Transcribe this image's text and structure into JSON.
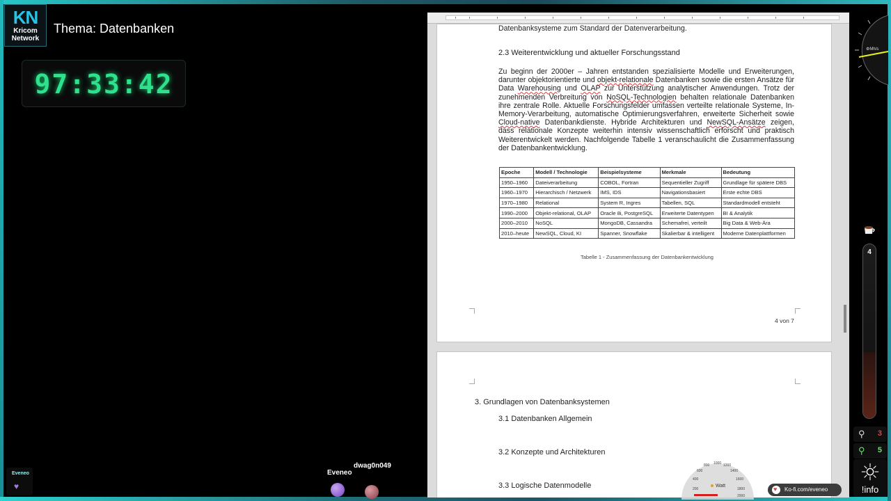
{
  "overlay": {
    "logo": {
      "big": "KN",
      "line1": "Kricom",
      "line2": "Network"
    },
    "title": "Thema: Datenbanken",
    "timer": "97:33:42",
    "mini_card_name": "Eveneo",
    "viewers": [
      "Eveneo",
      "dwag0n049"
    ],
    "speedo_label": "⚙Mh/s",
    "tube_value": "4",
    "stat_red": "3",
    "stat_green": "5",
    "info_label": "!info",
    "kofi": "Ko-fi.com/eveneo",
    "watt_label": "Watt",
    "watt_ticks": [
      "200",
      "400",
      "600",
      "800",
      "1000",
      "1200",
      "1400",
      "1600",
      "1800",
      "2000"
    ]
  },
  "page1": {
    "top_line": "Datenbanksysteme zum Standard der Datenverarbeitung.",
    "heading": "2.3 Weiterentwicklung und aktueller Forschungsstand",
    "para": [
      "Zu beginn der 2000er – Jahren entstanden spezialisierte Modelle und Erweiterungen, darunter objektorientierte und ",
      "objekt-relationale",
      " Datenbanken sowie die ersten Ansätze für Data ",
      "Warehousing",
      " und ",
      "OLAP",
      " zur Unterstützung analytischer Anwendungen. Trotz der zunehmenden Verbreitung von ",
      "NoSQL-Technologien",
      " behalten relationale Datenbanken ihre zentrale Rolle. Aktuelle Forschungsfelder umfassen verteilte relationale Systeme, In-Memory-Verarbeitung, automatische Optimierungsverfahren, erweiterte Sicherheit sowie ",
      "Cloud-native",
      " Datenbankdienste. Hybride Architekturen und ",
      "NewSQL-Ansätze",
      " zeigen, dass relationale Konzepte weiterhin intensiv wissenschaftlich erforscht und praktisch Weiterentwickelt werden. Nachfolgende Tabelle 1 veranschaulicht die Zusammenfassung der Datenbankentwicklung."
    ],
    "table": {
      "headers": [
        "Epoche",
        "Modell / Technologie",
        "Beispielsysteme",
        "Merkmale",
        "Bedeutung"
      ],
      "rows": [
        [
          "1950–1960",
          "Dateiverarbeitung",
          "COBOL, Fortran",
          "Sequentieller Zugriff",
          "Grundlage für spätere DBS"
        ],
        [
          "1960–1970",
          "Hierarchisch / Netzwerk",
          "IMS, IDS",
          "Navigationsbasiert",
          "Erste echte DBS"
        ],
        [
          "1970–1980",
          "Relational",
          "System R, Ingres",
          "Tabellen, SQL",
          "Standardmodell entsteht"
        ],
        [
          "1990–2000",
          "Objekt-relational, OLAP",
          "Oracle 8i, PostgreSQL",
          "Erweiterte Datentypen",
          "BI & Analytik"
        ],
        [
          "2000–2010",
          "NoSQL",
          "MongoDB, Cassandra",
          "Schemafrei, verteilt",
          "Big Data & Web-Ära"
        ],
        [
          "2010–heute",
          "NewSQL, Cloud, KI",
          "Spanner, Snowflake",
          "Skalierbar & intelligent",
          "Moderne Datenplattformen"
        ]
      ]
    },
    "caption": "Tabelle 1 - Zusammenfassung der Datenbankentwicklung",
    "pager": {
      "cur": "4",
      "sep": " von ",
      "total": "7"
    }
  },
  "page2": {
    "h3": "3. Grundlagen von Datenbanksystemen",
    "s1": "3.1 Datenbanken Allgemein",
    "s2": "3.2 Konzepte und Architekturen",
    "s3": "3.3 Logische Datenmodelle"
  }
}
